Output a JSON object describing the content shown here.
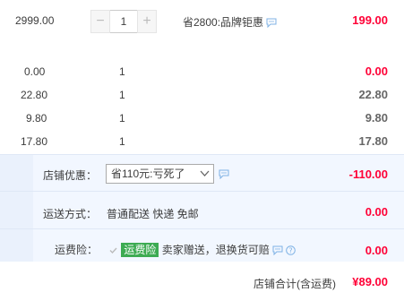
{
  "item": {
    "unit_price": "2999.00",
    "quantity": "1",
    "minus": "−",
    "plus": "+",
    "promo": "省2800:品牌钜惠",
    "subtotal": "199.00"
  },
  "rows": [
    {
      "price": "0.00",
      "qty": "1",
      "subtotal": "0.00"
    },
    {
      "price": "22.80",
      "qty": "1",
      "subtotal": "22.80"
    },
    {
      "price": "9.80",
      "qty": "1",
      "subtotal": "9.80"
    },
    {
      "price": "17.80",
      "qty": "1",
      "subtotal": "17.80"
    }
  ],
  "shop_discount": {
    "label": "店铺优惠：",
    "selected": "省110元:亏死了",
    "amount": "-110.00"
  },
  "shipping": {
    "label": "运送方式：",
    "value": "普通配送 快递 免邮",
    "amount": "0.00"
  },
  "insurance": {
    "label": "运费险：",
    "badge": "运费险",
    "text": "卖家赠送，退换货可赔",
    "amount": "0.00"
  },
  "total": {
    "label": "店铺合计(含运费)",
    "amount": "¥89.00"
  },
  "colors": {
    "accent_red": "#ff0036",
    "badge_green": "#3dab52",
    "section_bg": "#f2f7ff"
  }
}
